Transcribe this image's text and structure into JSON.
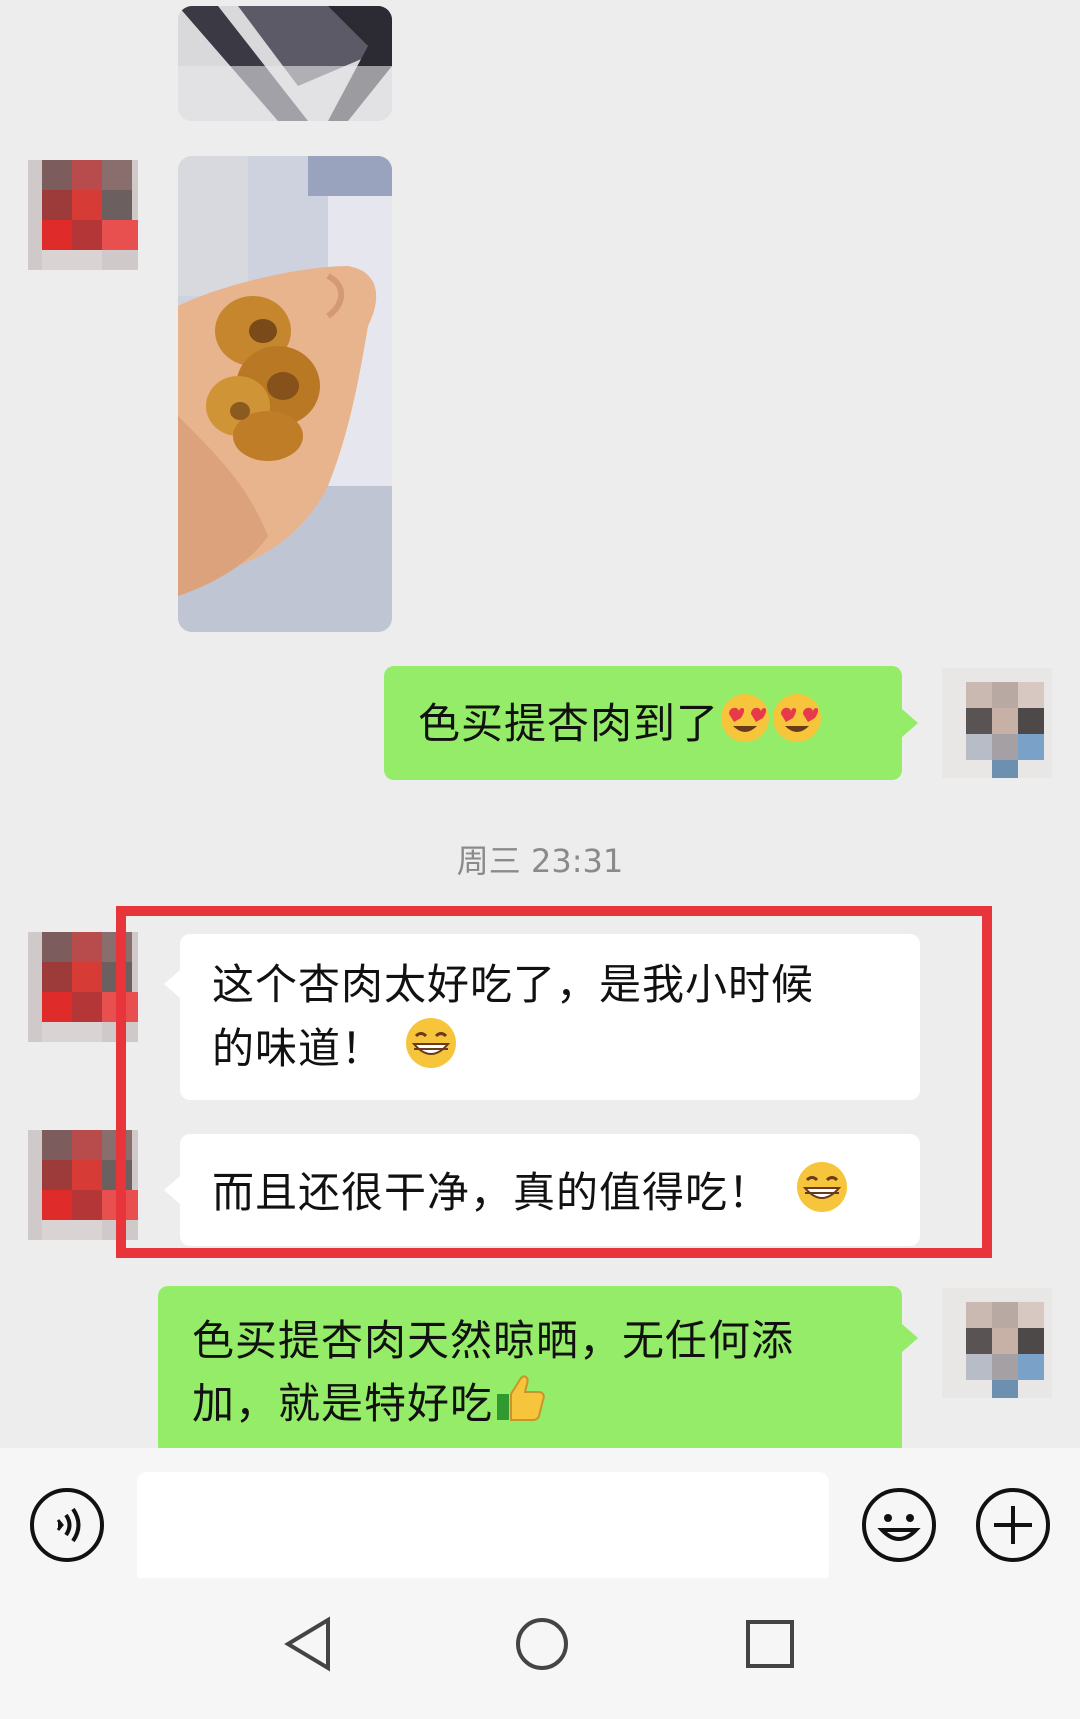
{
  "messages": [
    {
      "id": "m1",
      "from": "me",
      "text": "色买提杏肉到了",
      "emoji": [
        "heart-eyes-emoji",
        "heart-eyes-emoji"
      ]
    },
    {
      "id": "m2",
      "from": "them",
      "line1": "这个杏肉太好吃了，是我小时候",
      "line2": "的味道！",
      "emoji": [
        "grin-emoji"
      ]
    },
    {
      "id": "m3",
      "from": "them",
      "text": "而且还很干净，真的值得吃！",
      "emoji": [
        "grin-emoji"
      ]
    },
    {
      "id": "m4",
      "from": "me",
      "line1": "色买提杏肉天然晾晒，无任何添",
      "line2": "加，就是特好吃",
      "emoji": [
        "thumbs-up-emoji"
      ]
    }
  ],
  "timestamp": "周三 23:31",
  "input": {
    "placeholder": "",
    "value": ""
  },
  "icons": {
    "voice": "voice-icon",
    "emoji": "smiley-icon",
    "more": "plus-icon",
    "back": "back-triangle-icon",
    "home": "home-circle-icon",
    "recents": "recents-square-icon"
  },
  "colors": {
    "background": "#ededed",
    "sent_bubble": "#95ec69",
    "received_bubble": "#ffffff",
    "highlight_box": "#e8353b",
    "timestamp": "#8a8a8a"
  }
}
